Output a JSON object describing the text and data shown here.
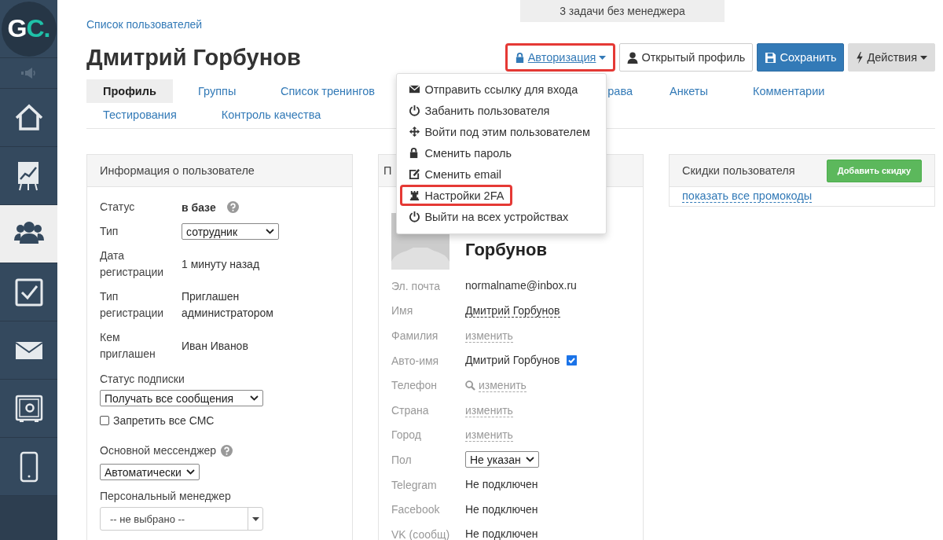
{
  "sidebar": {
    "logo": {
      "main": "G",
      "accent": "C."
    },
    "items": [
      {
        "kind": "home",
        "selected": false
      },
      {
        "kind": "chart",
        "selected": false
      },
      {
        "kind": "users",
        "selected": true
      },
      {
        "kind": "tasks",
        "selected": false
      },
      {
        "kind": "mail",
        "selected": false
      },
      {
        "kind": "safe",
        "selected": false
      },
      {
        "kind": "phone",
        "selected": false
      }
    ]
  },
  "notice": "3 задачи без менеджера",
  "breadcrumb": "Список пользователей",
  "title": "Дмитрий Горбунов",
  "actions": [
    {
      "kind": "auth",
      "label": "Авторизация",
      "highlighted": true
    },
    {
      "kind": "profile",
      "label": "Открытый профиль",
      "highlighted": false
    },
    {
      "kind": "save",
      "label": "Сохранить",
      "highlighted": false
    },
    {
      "kind": "more",
      "label": "Действия",
      "highlighted": false
    }
  ],
  "auth_menu": [
    {
      "kind": "send_link",
      "label": "Отправить ссылку для входа",
      "highlighted": false
    },
    {
      "kind": "ban",
      "label": "Забанить пользователя",
      "highlighted": false
    },
    {
      "kind": "impersonate",
      "label": "Войти под этим пользователем",
      "highlighted": false
    },
    {
      "kind": "password",
      "label": "Сменить пароль",
      "highlighted": false
    },
    {
      "kind": "email",
      "label": "Сменить email",
      "highlighted": false
    },
    {
      "kind": "twofa",
      "label": "Настройки 2FA",
      "highlighted": true
    },
    {
      "kind": "logout",
      "label": "Выйти на всех устройствах",
      "highlighted": false
    }
  ],
  "tab_rows": [
    [
      {
        "label": "Профиль",
        "selected": true
      },
      {
        "label": "Группы",
        "selected": false
      },
      {
        "label": "Список тренингов",
        "selected": false
      },
      {
        "label": "рава",
        "selected": false
      },
      {
        "label": "Анкеты",
        "selected": false
      },
      {
        "label": "Комментарии",
        "selected": false
      }
    ],
    [
      {
        "label": "Тестирования",
        "selected": false
      },
      {
        "label": "Контроль качества",
        "selected": false
      }
    ]
  ],
  "user_info": {
    "title": "Информация о пользователе",
    "rows": [
      {
        "kind": "status",
        "label": "Статус",
        "value": "в базе"
      },
      {
        "kind": "select",
        "label": "Тип",
        "value": "сотрудник"
      },
      {
        "kind": "text",
        "label": "Дата регистрации",
        "value": "1 минуту назад"
      },
      {
        "kind": "text",
        "label": "Тип регистрации",
        "value": "Приглашен администратором"
      },
      {
        "kind": "text",
        "label": "Кем приглашен",
        "value": "Иван Иванов"
      }
    ],
    "subscription": {
      "label": "Статус подписки",
      "value": "Получать все сообщения"
    },
    "sms_block": {
      "label": "Запретить все СМС",
      "checked": false
    },
    "messenger": {
      "label": "Основной мессенджер",
      "value": "Автоматически"
    },
    "manager": {
      "label": "Персональный менеджер",
      "placeholder": "-- не выбрано --"
    }
  },
  "contact": {
    "title": "П",
    "name": "Горбунов",
    "rows": [
      {
        "kind": "text",
        "label": "Эл. почта",
        "value": "normalname@inbox.ru"
      },
      {
        "kind": "editable",
        "label": "Имя",
        "value": "Дмитрий Горбунов"
      },
      {
        "kind": "link",
        "label": "Фамилия",
        "value": "изменить"
      },
      {
        "kind": "checkbox",
        "label": "Авто-имя",
        "value": "Дмитрий Горбунов",
        "checked": true
      },
      {
        "kind": "search_link",
        "label": "Телефон",
        "value": "изменить"
      },
      {
        "kind": "link",
        "label": "Страна",
        "value": "изменить"
      },
      {
        "kind": "link",
        "label": "Город",
        "value": "изменить"
      },
      {
        "kind": "select",
        "label": "Пол",
        "value": "Не указан"
      },
      {
        "kind": "text",
        "label": "Telegram",
        "value": "Не подключен"
      },
      {
        "kind": "text",
        "label": "Facebook",
        "value": "Не подключен"
      },
      {
        "kind": "text",
        "label": "VK (сообщ)",
        "value": "Не подключен"
      }
    ]
  },
  "discounts": {
    "title": "Скидки пользователя",
    "add_button": "Добавить скидку",
    "link": "показать все промокоды"
  }
}
